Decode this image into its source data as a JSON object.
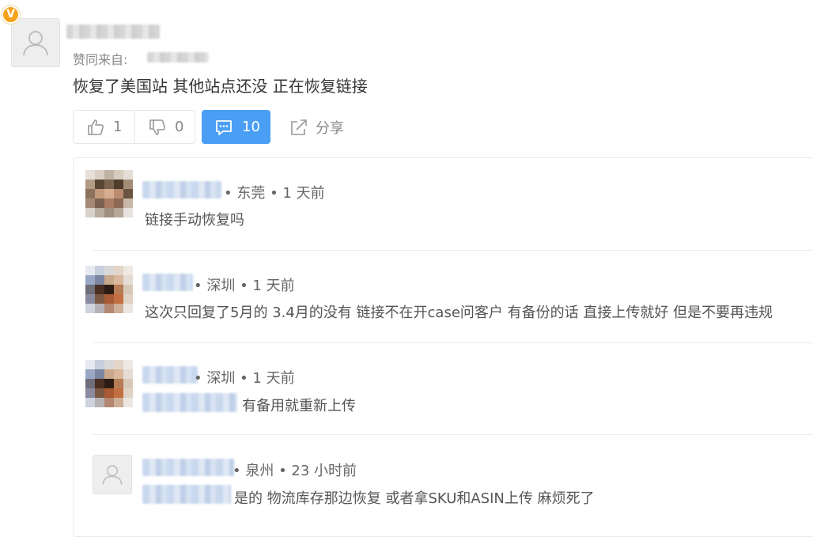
{
  "answer": {
    "badge_letter": "V",
    "agree_label": "赞同来自:",
    "text": "恢复了美国站 其他站点还没 正在恢复链接",
    "actions": {
      "upvote_count": "1",
      "downvote_count": "0",
      "comment_count": "10",
      "share_label": "分享"
    }
  },
  "comments": [
    {
      "location": "• 东莞",
      "time": "• 1 天前",
      "text": "链接手动恢复吗"
    },
    {
      "location": "• 深圳",
      "time": "• 1 天前",
      "text": "这次只回复了5月的 3.4月的没有 链接不在开case问客户 有备份的话 直接上传就好 但是不要再违规"
    },
    {
      "location": "• 深圳",
      "time": "• 1 天前",
      "text": "有备用就重新上传"
    },
    {
      "location": "• 泉州",
      "time": "• 23 小时前",
      "text": "是的 物流库存那边恢复 或者拿SKU和ASIN上传 麻烦死了"
    }
  ],
  "colors": {
    "accent": "#4a9ff5",
    "vip_badge": "#f7a21b",
    "muted_text": "#888888"
  }
}
